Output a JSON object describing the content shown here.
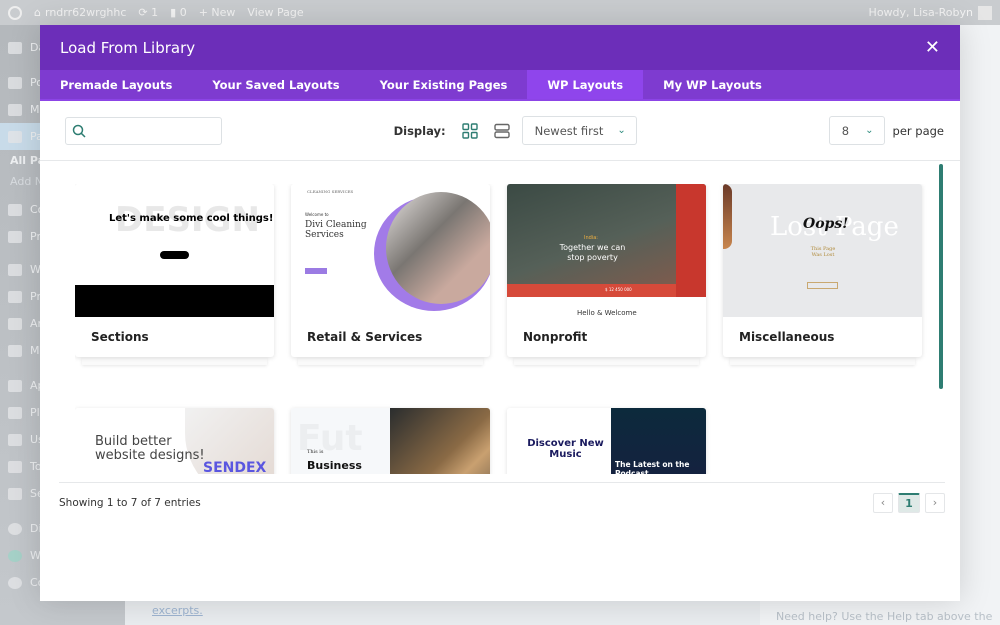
{
  "adminbar": {
    "site": "rndrr62wrghhc",
    "updates": "1",
    "comments": "0",
    "new": "+ New",
    "view": "View Page",
    "howdy": "Howdy, Lisa-Robyn"
  },
  "sidebar": {
    "items": [
      "Da",
      "Po",
      "Me",
      "Pa"
    ],
    "sub": [
      "All Pa",
      "Add N"
    ],
    "items2": [
      "Co",
      "Pr",
      "W",
      "Pr",
      "An",
      "Ma",
      "Ap",
      "Pl",
      "Us",
      "To",
      "Se",
      "Di",
      "W",
      "Co"
    ]
  },
  "background": {
    "link": "excerpts.",
    "help": "Need help? Use the Help tab above the"
  },
  "modal": {
    "title": "Load From Library",
    "close": "✕",
    "tabs": [
      {
        "label": "Premade Layouts"
      },
      {
        "label": "Your Saved Layouts"
      },
      {
        "label": "Your Existing Pages"
      },
      {
        "label": "WP Layouts",
        "active": true
      },
      {
        "label": "My WP Layouts"
      }
    ],
    "search": {
      "placeholder": "",
      "value": ""
    },
    "display_label": "Display:",
    "sort": "Newest first",
    "per_page_value": "8",
    "per_page_label": "per page",
    "cards": [
      {
        "label": "Sections",
        "thumb": {
          "bg_word": "DESIGN",
          "headline": "Let's make some cool things!"
        }
      },
      {
        "label": "Retail & Services",
        "thumb": {
          "brand": "CLEANING SERVICES",
          "kicker": "Welcome to",
          "headline": "Divi Cleaning Services"
        }
      },
      {
        "label": "Nonprofit",
        "thumb": {
          "kicker": "India:",
          "headline": "Together we can stop poverty",
          "below": "Hello & Welcome",
          "amount": "$ 12 450 000"
        }
      },
      {
        "label": "Miscellaneous",
        "thumb": {
          "bg_word": "Lost Page",
          "headline": "Oops!",
          "sub": "This Page Was Lost"
        }
      },
      {
        "label": "",
        "thumb": {
          "headline": "Build better website designs!",
          "brand": "SENDEX"
        }
      },
      {
        "label": "",
        "thumb": {
          "bg_word": "Fut",
          "kicker": "This is",
          "headline": "Business Layout"
        }
      },
      {
        "label": "",
        "thumb": {
          "headline": "Discover New Music",
          "sub": "The Latest on the Podcast"
        }
      }
    ],
    "showing": "Showing 1 to 7 of 7 entries",
    "pager": {
      "prev": "‹",
      "current": "1",
      "next": "›"
    },
    "accent": "#2e7d72",
    "header_color": "#6c2eb9",
    "tab_color": "#7e3bd0"
  }
}
